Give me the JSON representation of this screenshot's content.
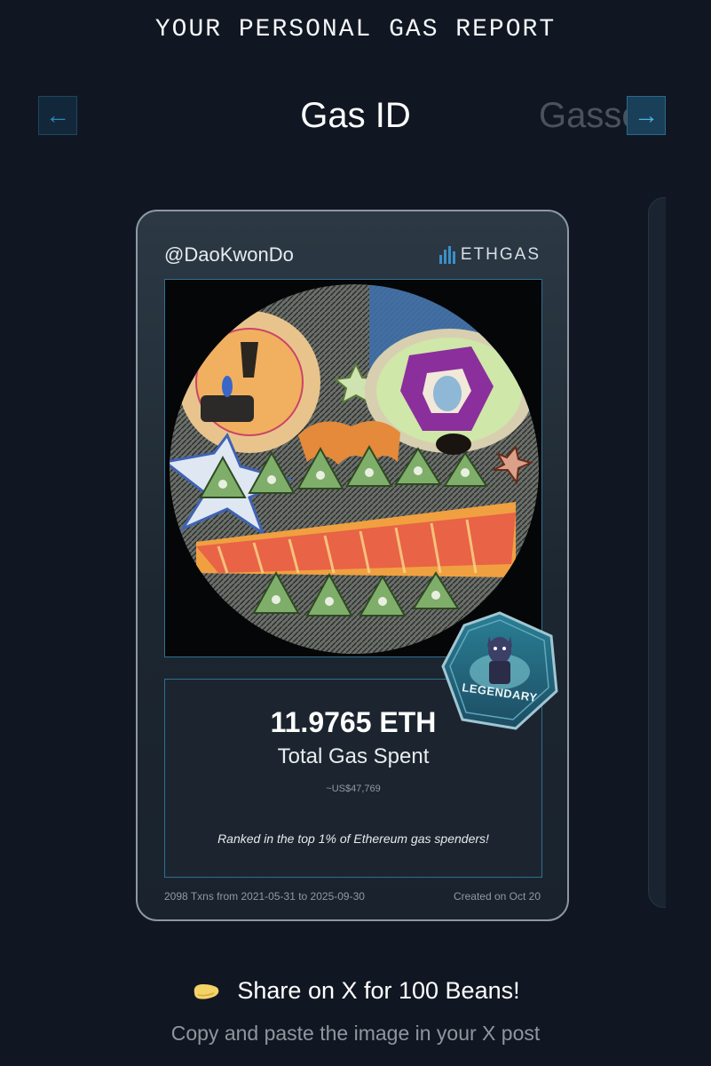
{
  "header": {
    "title": "YOUR PERSONAL GAS REPORT"
  },
  "nav": {
    "prev_icon": "arrow-left-icon",
    "next_icon": "arrow-right-icon",
    "prev_glyph": "←",
    "next_glyph": "→",
    "current_title": "Gas ID",
    "next_title": "Gassed"
  },
  "card": {
    "handle": "@DaoKwonDo",
    "brand": "ETHGAS",
    "badge_label": "LEGENDARY",
    "eth_amount": "11.9765 ETH",
    "eth_label": "Total Gas Spent",
    "usd_value": "~US$47,769",
    "rank_text": "Ranked in the top 1% of Ethereum gas spenders!",
    "footer_txns": "2098 Txns from 2021-05-31 to 2025-09-30",
    "footer_created": "Created on Oct 20"
  },
  "share": {
    "icon": "bean-icon",
    "label": "Share on X for 100 Beans!",
    "subtext": "Copy and paste the image in your X post"
  },
  "colors": {
    "background": "#101722",
    "accent": "#3b8fc7",
    "card_border": "#8e98a3"
  }
}
